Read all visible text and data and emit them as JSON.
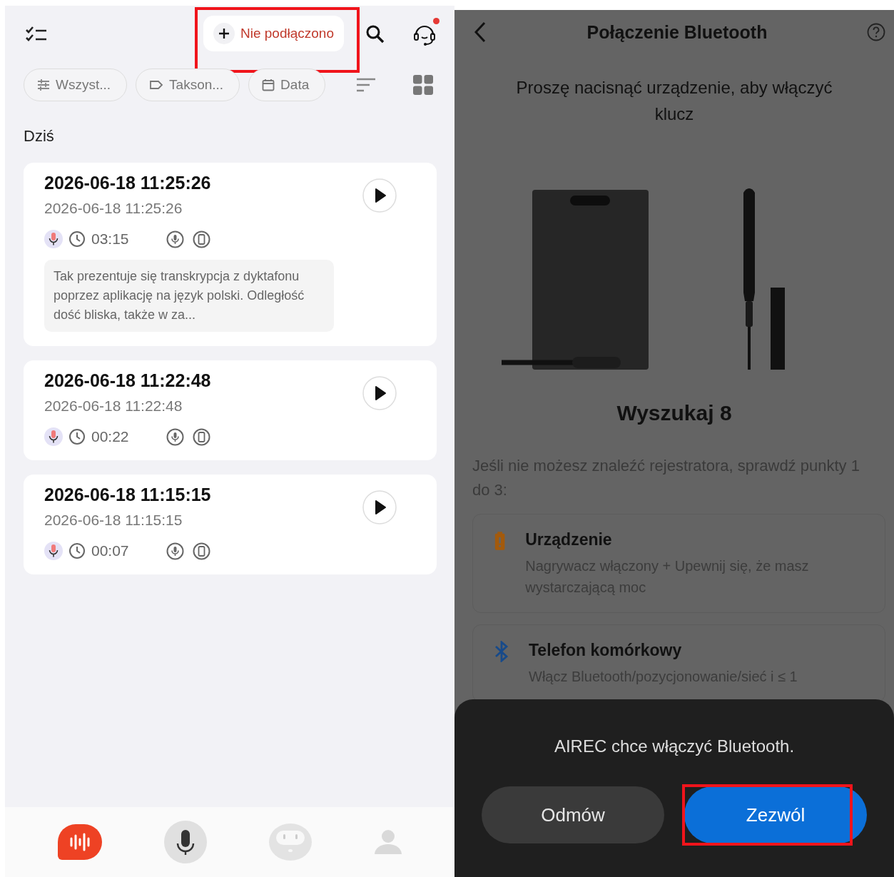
{
  "left_screen": {
    "connect_button": {
      "label": "Nie podłączono",
      "highlighted": true
    },
    "has_notification": true,
    "filters": [
      {
        "kind": "sliders",
        "label": "Wszyst..."
      },
      {
        "kind": "tag",
        "label": "Takson..."
      },
      {
        "kind": "calendar",
        "label": "Data"
      }
    ],
    "section_title": "Dziś",
    "recordings": [
      {
        "title": "2026-06-18 11:25:26",
        "subtitle": "2026-06-18 11:25:26",
        "duration": "03:15",
        "excerpt": "Tak prezentuje się transkrypcja z dyktafonu poprzez aplikację na język polski. Odległość dość bliska, także w za..."
      },
      {
        "title": "2026-06-18 11:22:48",
        "subtitle": "2026-06-18 11:22:48",
        "duration": "00:22"
      },
      {
        "title": "2026-06-18 11:15:15",
        "subtitle": "2026-06-18 11:15:15",
        "duration": "00:07"
      }
    ],
    "bottom_nav": [
      {
        "kind": "recordings",
        "selected": true
      },
      {
        "kind": "microphone",
        "selected": false
      },
      {
        "kind": "assistant",
        "selected": false
      },
      {
        "kind": "profile",
        "selected": false
      }
    ]
  },
  "right_screen": {
    "title": "Połączenie Bluetooth",
    "instruction": "Proszę nacisnąć urządzenie, aby włączyć klucz",
    "search_status": "Wyszukaj 8",
    "hint": "Jeśli nie możesz znaleźć rejestratora, sprawdź punkty 1 do 3:",
    "tips": [
      {
        "kind": "battery",
        "title": "Urządzenie",
        "text": "Nagrywacz włączony + Upewnij się, że masz wystarczającą moc"
      },
      {
        "kind": "bluetooth",
        "title": "Telefon komórkowy",
        "text": "Włącz Bluetooth/pozycjonowanie/sieć i ≤ 1"
      }
    ],
    "dialog": {
      "message": "AIREC chce włączyć Bluetooth.",
      "buttons": [
        {
          "kind": "secondary",
          "label": "Odmów",
          "highlighted": false
        },
        {
          "kind": "primary",
          "label": "Zezwól",
          "highlighted": true
        }
      ]
    }
  }
}
